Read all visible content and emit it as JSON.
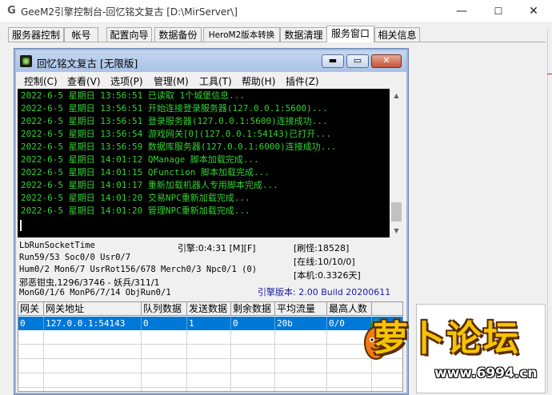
{
  "outer_window": {
    "title": "GeeM2引擎控制台-回忆铭文复古 [D:\\MirServer\\]",
    "logo_glyph": "G",
    "minimize_glyph": "—",
    "maximize_glyph": "☐",
    "close_glyph": "✕"
  },
  "tabs": [
    {
      "label": "服务器控制"
    },
    {
      "label": "帐号"
    },
    {
      "label": "配置向导"
    },
    {
      "label": "数据备份"
    },
    {
      "label": "HeroM2版本转换"
    },
    {
      "label": "数据清理"
    },
    {
      "label": "服务窗口"
    },
    {
      "label": "相关信息"
    }
  ],
  "active_tab": 6,
  "inner_window": {
    "title": "回忆铭文复古 [无限版]",
    "minimize_glyph": "▬",
    "maximize_glyph": "▭",
    "close_glyph": "✕",
    "menu": [
      {
        "label": "控制(C)"
      },
      {
        "label": "查看(V)"
      },
      {
        "label": "选项(P)"
      },
      {
        "label": "管理(M)"
      },
      {
        "label": "工具(T)"
      },
      {
        "label": "帮助(H)"
      },
      {
        "label": "插件(Z)"
      }
    ]
  },
  "console_log": [
    "2022-6-5 星期日 13:56:51 已读取 1个城堡信息...",
    "2022-6-5 星期日 13:56:51 开始连接登录服务器(127.0.0.1:5600)...",
    "2022-6-5 星期日 13:56:51 登录服务器(127.0.0.1:5600)连接成功...",
    "2022-6-5 星期日 13:56:54 游戏网关[0](127.0.0.1:54143)已打开...",
    "2022-6-5 星期日 13:56:59 数据库服务器(127.0.0.1:6000)连接成功...",
    "2022-6-5 星期日 14:01:12 QManage 脚本加载完成...",
    "2022-6-5 星期日 14:01:15 QFunction 脚本加载完成...",
    "2022-6-5 星期日 14:01:17 重新加载机器人专用脚本完成...",
    "2022-6-5 星期日 14:01:20 交易NPC重新加载完成...",
    "2022-6-5 星期日 14:01:20 管理NPC重新加载完成..."
  ],
  "scrollbar": {
    "up_glyph": "▲",
    "down_glyph": "▼"
  },
  "status": {
    "socket_time": "LbRunSocketTime",
    "engine_time": "引擎:0:4:31 [M][F]",
    "refresh_monsters": "[刷怪:18528]",
    "run_info": "Run59/53 Soc0/0 Usr0/7",
    "online": "[在线:10/10/0]",
    "hum_info": "Hum0/2 Mon6/7 UsrRot156/678 Merch0/3 Npc0/1 (0)",
    "local": "[本机:0.3326天]",
    "mob_info": "邪恶钳虫,1296/3746 - 妖兵/311/1",
    "mon_info": "MonG0/1/6 MonP6/7/14 ObjRun0/1",
    "engine_version": "引擎版本: 2.00 Build 20200611"
  },
  "grid": {
    "columns": [
      "网关",
      "网关地址",
      "队列数据",
      "发送数据",
      "剩余数据",
      "平均流量",
      "最高人数"
    ],
    "rows": [
      [
        "0",
        "127.0.0.1:54143",
        "0",
        "1",
        "0",
        "20b",
        "0/0"
      ]
    ]
  },
  "watermark": {
    "title": "萝卜论坛",
    "url": "www.6994.cn"
  }
}
